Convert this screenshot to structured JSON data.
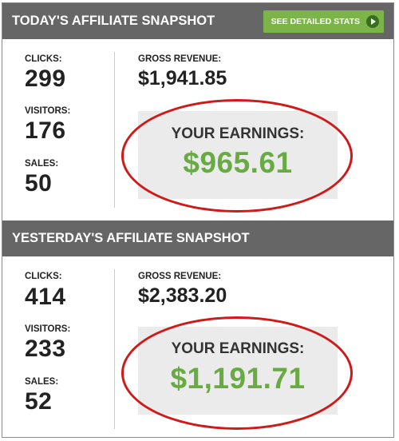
{
  "today": {
    "title": "TODAY'S AFFILIATE SNAPSHOT",
    "button_label": "SEE DETAILED STATS",
    "clicks_label": "CLICKS:",
    "clicks_value": "299",
    "visitors_label": "VISITORS:",
    "visitors_value": "176",
    "sales_label": "SALES:",
    "sales_value": "50",
    "gross_label": "GROSS REVENUE:",
    "gross_value": "$1,941.85",
    "earnings_label": "YOUR EARNINGS:",
    "earnings_value": "$965.61"
  },
  "yesterday": {
    "title": "YESTERDAY'S AFFILIATE SNAPSHOT",
    "clicks_label": "CLICKS:",
    "clicks_value": "414",
    "visitors_label": "VISITORS:",
    "visitors_value": "233",
    "sales_label": "SALES:",
    "sales_value": "52",
    "gross_label": "GROSS REVENUE:",
    "gross_value": "$2,383.20",
    "earnings_label": "YOUR EARNINGS:",
    "earnings_value": "$1,191.71"
  },
  "colors": {
    "header_bg": "#666666",
    "button_bg": "#7db44a",
    "earnings_text": "#6aaa45",
    "highlight_ring": "#d01a1a"
  },
  "icons": {
    "button_icon": "play-circle-icon"
  }
}
